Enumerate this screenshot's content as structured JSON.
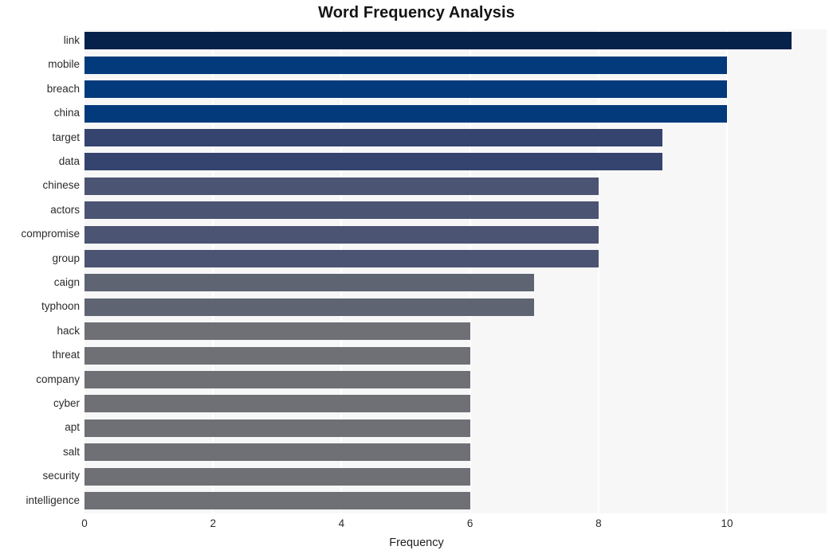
{
  "chart_data": {
    "type": "bar",
    "orientation": "horizontal",
    "title": "Word Frequency Analysis",
    "xlabel": "Frequency",
    "ylabel": "",
    "xlim": [
      0,
      11.55
    ],
    "xticks": [
      0,
      2,
      4,
      6,
      8,
      10
    ],
    "xtick_labels": [
      "0",
      "2",
      "4",
      "6",
      "8",
      "10"
    ],
    "grid": "vertical-white",
    "legend": "none",
    "categories": [
      "link",
      "mobile",
      "breach",
      "china",
      "target",
      "data",
      "chinese",
      "actors",
      "compromise",
      "group",
      "caign",
      "typhoon",
      "hack",
      "threat",
      "company",
      "cyber",
      "apt",
      "salt",
      "security",
      "intelligence"
    ],
    "values": [
      11,
      10,
      10,
      10,
      9,
      9,
      8,
      8,
      8,
      8,
      7,
      7,
      6,
      6,
      6,
      6,
      6,
      6,
      6,
      6
    ],
    "bar_colors": [
      "#06214a",
      "#033madeup",
      "#033a7c",
      "#033a7c",
      "#35436f",
      "#35436f",
      "#4b5472",
      "#4b5472",
      "#4b5472",
      "#4b5472",
      "#5e6472",
      "#5e6472",
      "#6e7076",
      "#6e7076",
      "#6e7076",
      "#6e7076",
      "#6e7076",
      "#6e7076",
      "#6e7076",
      "#6e7076"
    ],
    "plot_background": "#f7f7f7",
    "figure_background": "#ffffff",
    "title_color": "#141414",
    "tick_color": "#2b2b2b"
  }
}
